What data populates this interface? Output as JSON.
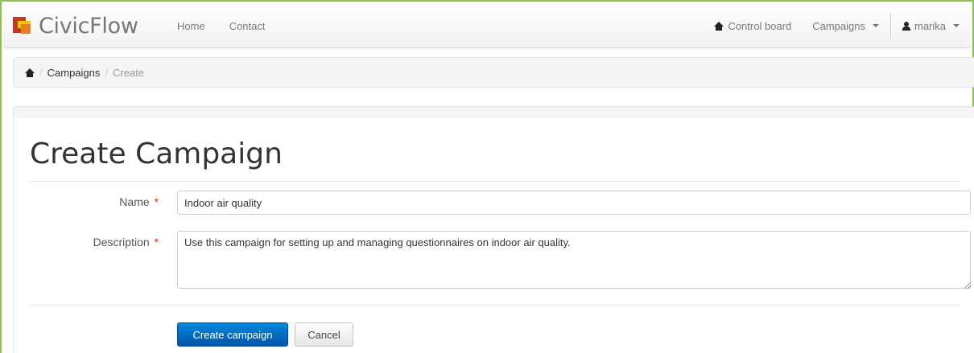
{
  "brand": {
    "name": "CivicFlow"
  },
  "nav": {
    "home": "Home",
    "contact": "Contact",
    "control_board": "Control board",
    "campaigns": "Campaigns",
    "user": "marika"
  },
  "breadcrumb": {
    "separator": "/",
    "items": [
      "Campaigns",
      "Create"
    ]
  },
  "form": {
    "title": "Create Campaign",
    "name_label": "Name",
    "name_value": "Indoor air quality",
    "description_label": "Description",
    "description_value": "Use this campaign for setting up and managing questionnaires on indoor air quality.",
    "required_marker": "*",
    "submit_label": "Create campaign",
    "cancel_label": "Cancel"
  },
  "colors": {
    "accent": "#0066cc",
    "frame": "#8bc34a",
    "required": "#c0392b"
  }
}
